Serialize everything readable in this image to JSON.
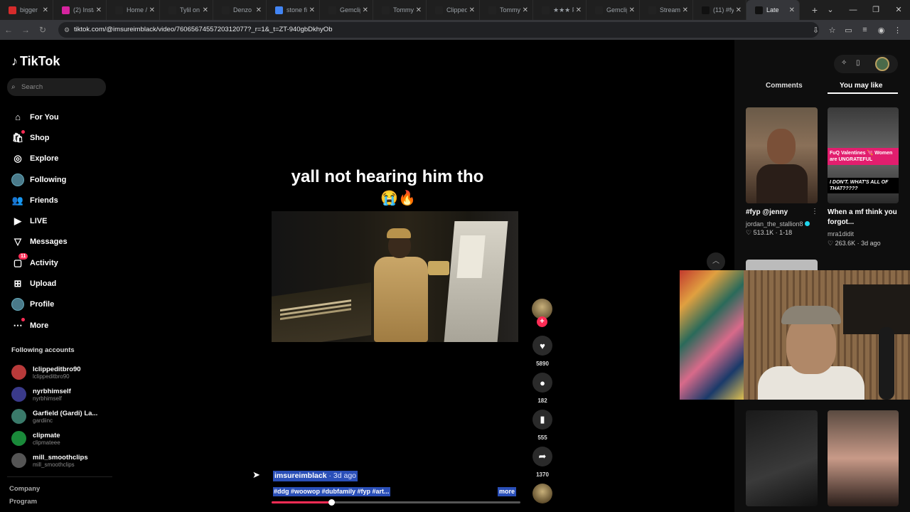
{
  "browser": {
    "tabs": [
      {
        "title": "bigger",
        "favicon_color": "#d62b2b"
      },
      {
        "title": "(2) Insta",
        "favicon_color": "#d6249f"
      },
      {
        "title": "Home /",
        "favicon_color": "#222222"
      },
      {
        "title": "Tylil on",
        "favicon_color": "#222222"
      },
      {
        "title": "Denzo",
        "favicon_color": "#222222"
      },
      {
        "title": "stone fi",
        "favicon_color": "#4285f4"
      },
      {
        "title": "Gemclip",
        "favicon_color": "#222222"
      },
      {
        "title": "Tommy",
        "favicon_color": "#222222"
      },
      {
        "title": "Clipped",
        "favicon_color": "#222222"
      },
      {
        "title": "Tommy",
        "favicon_color": "#222222"
      },
      {
        "title": "★★★ F",
        "favicon_color": "#222222"
      },
      {
        "title": "Gemclip",
        "favicon_color": "#222222"
      },
      {
        "title": "Stream",
        "favicon_color": "#222222"
      },
      {
        "title": "(11) #fy",
        "favicon_color": "#111111"
      },
      {
        "title": "Late",
        "favicon_color": "#111111"
      }
    ],
    "url": "tiktok.com/@imsureimblack/video/7606567455720312077?_r=1&_t=ZT-940gbDkhyOb"
  },
  "sidebar": {
    "brand": "TikTok",
    "search_placeholder": "Search",
    "nav": [
      {
        "label": "For You",
        "icon": "home-icon"
      },
      {
        "label": "Shop",
        "icon": "shop-icon"
      },
      {
        "label": "Explore",
        "icon": "explore-icon"
      },
      {
        "label": "Following",
        "icon": "following-avatar-icon"
      },
      {
        "label": "Friends",
        "icon": "friends-icon"
      },
      {
        "label": "LIVE",
        "icon": "live-icon"
      },
      {
        "label": "Messages",
        "icon": "messages-icon"
      },
      {
        "label": "Activity",
        "icon": "activity-icon",
        "badge": "11"
      },
      {
        "label": "Upload",
        "icon": "upload-icon"
      },
      {
        "label": "Profile",
        "icon": "profile-icon"
      },
      {
        "label": "More",
        "icon": "more-icon"
      }
    ],
    "following_title": "Following accounts",
    "following": [
      {
        "name": "lclippeditbro90",
        "handle": "lclippeditbro90",
        "color": "#b83a3a"
      },
      {
        "name": "nyrbhimself",
        "handle": "nyrbhimself",
        "color": "#3a3a8a"
      },
      {
        "name": "Garfield (Gardi) La...",
        "handle": "gardiinc",
        "color": "#3a7a6a"
      },
      {
        "name": "clipmate",
        "handle": "clipmateee",
        "color": "#1a8a3a"
      },
      {
        "name": "mill_smoothclips",
        "handle": "mill_smoothclips",
        "color": "#555555"
      }
    ],
    "footer": [
      "Company",
      "Program"
    ]
  },
  "video": {
    "caption": "yall not hearing him tho",
    "emojis": "😭🔥",
    "author": "imsureimblack",
    "time_ago": " · 3d ago",
    "tags": "#ddg #woowop #dubfamily #fyp #art...",
    "more_label": "more",
    "likes": "5890",
    "comments": "182",
    "saves": "555",
    "shares": "1370",
    "progress": 0.24
  },
  "right_panel": {
    "tabs": [
      "Comments",
      "You may like"
    ],
    "cards": [
      {
        "title": "#fyp @jenny",
        "user": "jordan_the_stallion8",
        "verified": true,
        "stats": "♡ 513.1K · 1-18"
      },
      {
        "title": "When a mf think you forgot...",
        "user": "mra1didit",
        "verified": false,
        "stats": "♡ 263.6K · 3d ago",
        "banner_pink": "FuQ Valentines 💘 Women are UNGRATEFUL",
        "banner_black": "I DON'T. WHAT'S ALL OF THAT?????"
      }
    ]
  }
}
